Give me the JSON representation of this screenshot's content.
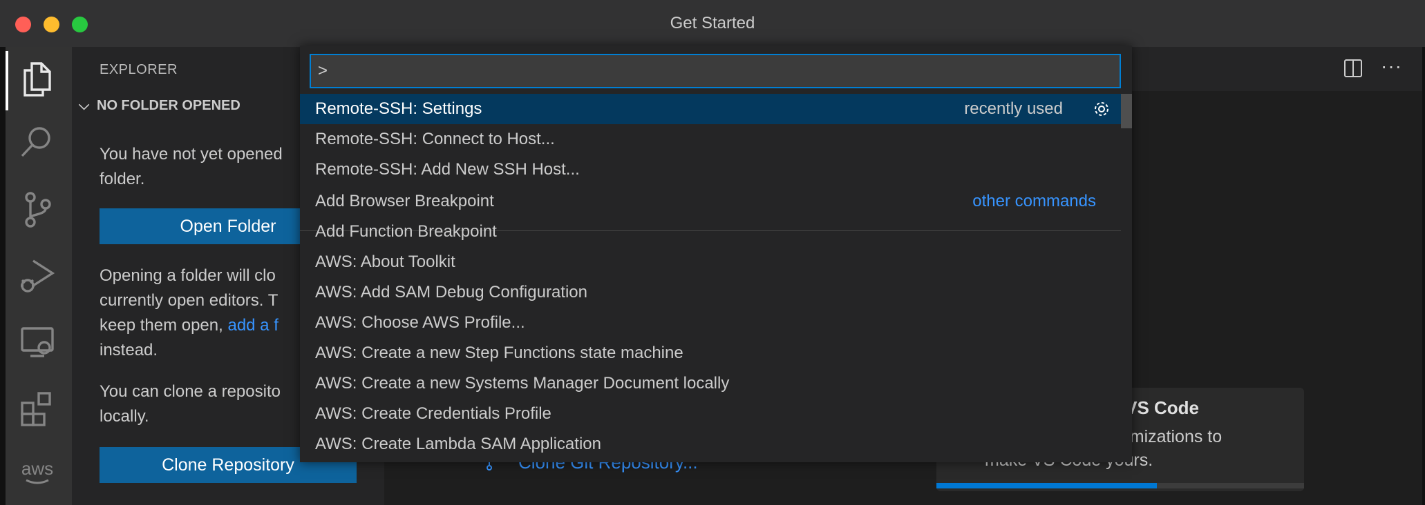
{
  "window": {
    "title": "Get Started"
  },
  "activity_bar": {
    "items": [
      {
        "name": "explorer",
        "icon": "files-icon",
        "active": true
      },
      {
        "name": "search",
        "icon": "search-icon"
      },
      {
        "name": "source-control",
        "icon": "source-control-icon"
      },
      {
        "name": "run-debug",
        "icon": "run-debug-icon"
      },
      {
        "name": "remote-explorer",
        "icon": "remote-explorer-icon"
      },
      {
        "name": "extensions",
        "icon": "extensions-icon"
      },
      {
        "name": "aws",
        "icon": "aws-icon",
        "label": "aws"
      }
    ]
  },
  "sidebar": {
    "title": "EXPLORER",
    "section": "NO FOLDER OPENED",
    "text1_line1": "You have not yet opened",
    "text1_line2": "folder.",
    "open_folder_button": "Open Folder",
    "text2_line1": "Opening a folder will clo",
    "text2_line2": "currently open editors. T",
    "text2_line3_prefix": "keep them open, ",
    "text2_line3_link": "add a f",
    "text2_line4": "instead.",
    "text3_line1": "You can clone a reposito",
    "text3_line2": "locally.",
    "clone_button": "Clone Repository"
  },
  "editor": {
    "clone_link": "Clone Git Repository...",
    "card_title": "n VS Code",
    "card_desc_line1": "customizations to",
    "card_desc_line2": "make VS Code yours.",
    "progress_fraction": 0.6
  },
  "command_palette": {
    "input_value": ">",
    "items": [
      {
        "label": "Remote-SSH: Settings",
        "tag": "recently used",
        "selected": true
      },
      {
        "label": "Remote-SSH: Connect to Host..."
      },
      {
        "label": "Remote-SSH: Add New SSH Host..."
      },
      {
        "label": "Add Browser Breakpoint",
        "tag": "other commands"
      },
      {
        "label": "Add Function Breakpoint"
      },
      {
        "label": "AWS: About Toolkit"
      },
      {
        "label": "AWS: Add SAM Debug Configuration"
      },
      {
        "label": "AWS: Choose AWS Profile..."
      },
      {
        "label": "AWS: Create a new Step Functions state machine"
      },
      {
        "label": "AWS: Create a new Systems Manager Document locally"
      },
      {
        "label": "AWS: Create Credentials Profile"
      },
      {
        "label": "AWS: Create Lambda SAM Application"
      }
    ]
  },
  "colors": {
    "accent": "#007fd4",
    "button": "#0e639c",
    "selection": "#04395e",
    "link": "#3794ff"
  }
}
